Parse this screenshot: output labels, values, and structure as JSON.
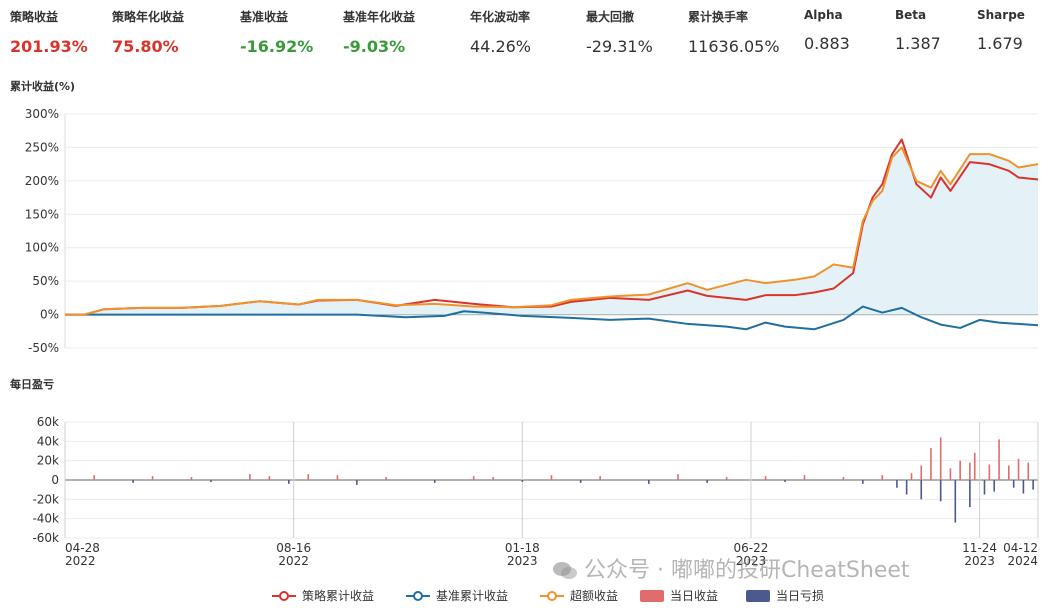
{
  "metrics": [
    {
      "label": "策略收益",
      "value": "201.93%",
      "tone": "red"
    },
    {
      "label": "策略年化收益",
      "value": "75.80%",
      "tone": "red"
    },
    {
      "label": "基准收益",
      "value": "-16.92%",
      "tone": "green"
    },
    {
      "label": "基准年化收益",
      "value": "-9.03%",
      "tone": "green"
    },
    {
      "label": "年化波动率",
      "value": "44.26%",
      "tone": "plain"
    },
    {
      "label": "最大回撤",
      "value": "-29.31%",
      "tone": "plain"
    },
    {
      "label": "累计换手率",
      "value": "11636.05%",
      "tone": "plain"
    },
    {
      "label": "Alpha",
      "value": "0.883",
      "tone": "plain"
    },
    {
      "label": "Beta",
      "value": "1.387",
      "tone": "plain"
    },
    {
      "label": "Sharpe",
      "value": "1.679",
      "tone": "plain"
    }
  ],
  "chart_data": [
    {
      "type": "line",
      "title": "累计收益(%)",
      "ylabel": "",
      "yticks": [
        "300%",
        "250%",
        "200%",
        "150%",
        "100%",
        "50%",
        "0%",
        "-50%"
      ],
      "ylim": [
        -50,
        300
      ],
      "x_range": [
        "2022-04-28",
        "2024-04-12"
      ],
      "series": [
        {
          "name": "策略累计收益",
          "color": "#d9342b",
          "t": [
            0,
            0.02,
            0.04,
            0.08,
            0.12,
            0.16,
            0.2,
            0.24,
            0.26,
            0.3,
            0.34,
            0.38,
            0.42,
            0.46,
            0.5,
            0.52,
            0.56,
            0.6,
            0.64,
            0.66,
            0.7,
            0.72,
            0.75,
            0.77,
            0.79,
            0.81,
            0.82,
            0.83,
            0.84,
            0.85,
            0.86,
            0.875,
            0.89,
            0.9,
            0.91,
            0.93,
            0.95,
            0.97,
            0.98,
            1.0
          ],
          "values": [
            0,
            0,
            8,
            10,
            10,
            13,
            20,
            15,
            21,
            22,
            13,
            22,
            16,
            11,
            12,
            19,
            25,
            22,
            36,
            28,
            22,
            29,
            29,
            33,
            39,
            62,
            135,
            175,
            195,
            240,
            262,
            195,
            175,
            205,
            185,
            228,
            225,
            215,
            205,
            202
          ]
        },
        {
          "name": "基准累计收益",
          "color": "#1f6fa0",
          "t": [
            0,
            0.2,
            0.3,
            0.35,
            0.39,
            0.41,
            0.43,
            0.47,
            0.52,
            0.56,
            0.6,
            0.64,
            0.68,
            0.7,
            0.72,
            0.74,
            0.77,
            0.8,
            0.82,
            0.84,
            0.86,
            0.88,
            0.9,
            0.92,
            0.94,
            0.96,
            0.98,
            1.0
          ],
          "values": [
            0,
            0,
            0,
            -4,
            -2,
            5,
            3,
            -2,
            -5,
            -8,
            -6,
            -14,
            -18,
            -22,
            -12,
            -18,
            -22,
            -8,
            12,
            3,
            10,
            -4,
            -15,
            -20,
            -8,
            -12,
            -14,
            -16
          ]
        },
        {
          "name": "超额收益",
          "color": "#f0922b",
          "fill": "#e4f2f8",
          "t": [
            0,
            0.02,
            0.04,
            0.08,
            0.12,
            0.16,
            0.2,
            0.24,
            0.26,
            0.3,
            0.34,
            0.38,
            0.42,
            0.46,
            0.5,
            0.52,
            0.56,
            0.6,
            0.64,
            0.66,
            0.7,
            0.72,
            0.75,
            0.77,
            0.79,
            0.81,
            0.82,
            0.83,
            0.84,
            0.85,
            0.86,
            0.875,
            0.89,
            0.9,
            0.91,
            0.93,
            0.95,
            0.97,
            0.98,
            1.0
          ],
          "values": [
            0,
            0,
            8,
            10,
            10,
            13,
            20,
            15,
            22,
            22,
            14,
            16,
            12,
            11,
            14,
            22,
            27,
            30,
            47,
            37,
            52,
            47,
            52,
            57,
            75,
            70,
            140,
            170,
            185,
            235,
            250,
            200,
            190,
            215,
            195,
            240,
            240,
            230,
            220,
            225
          ]
        }
      ]
    },
    {
      "type": "bar",
      "title": "每日盈亏",
      "yticks": [
        "60k",
        "40k",
        "20k",
        "0",
        "-20k",
        "-40k",
        "-60k"
      ],
      "ylim": [
        -60000,
        60000
      ],
      "xticks": [
        {
          "t": 0.0,
          "date": "04-28",
          "year": "2022"
        },
        {
          "t": 0.235,
          "date": "08-16",
          "year": "2022"
        },
        {
          "t": 0.47,
          "date": "01-18",
          "year": "2023"
        },
        {
          "t": 0.705,
          "date": "06-22",
          "year": "2023"
        },
        {
          "t": 0.94,
          "date": "11-24",
          "year": "2023"
        },
        {
          "t": 1.0,
          "date": "04-12",
          "year": "2024"
        }
      ],
      "series": [
        {
          "name": "当日收益",
          "color": "#e06c6c",
          "t": [
            0.03,
            0.09,
            0.13,
            0.19,
            0.21,
            0.25,
            0.28,
            0.33,
            0.42,
            0.44,
            0.5,
            0.55,
            0.63,
            0.68,
            0.72,
            0.76,
            0.8,
            0.84,
            0.87,
            0.88,
            0.89,
            0.9,
            0.91,
            0.92,
            0.93,
            0.935,
            0.95,
            0.96,
            0.97,
            0.98,
            0.99
          ],
          "values": [
            5000,
            4000,
            3000,
            6000,
            4000,
            6000,
            5000,
            3000,
            4000,
            3000,
            5000,
            4000,
            6000,
            3000,
            4000,
            5000,
            3000,
            5000,
            7000,
            15000,
            33000,
            44000,
            12000,
            20000,
            18000,
            28000,
            16000,
            42000,
            15000,
            22000,
            18000
          ]
        },
        {
          "name": "当日亏损",
          "color": "#4a5a8f",
          "t": [
            0.07,
            0.15,
            0.23,
            0.3,
            0.38,
            0.47,
            0.53,
            0.6,
            0.66,
            0.74,
            0.82,
            0.855,
            0.865,
            0.88,
            0.9,
            0.915,
            0.93,
            0.945,
            0.955,
            0.975,
            0.985,
            0.995
          ],
          "values": [
            -3000,
            -2000,
            -4000,
            -5000,
            -3000,
            -2000,
            -3000,
            -4000,
            -3000,
            -2000,
            -4000,
            -8000,
            -15000,
            -20000,
            -22000,
            -44000,
            -28000,
            -15000,
            -12000,
            -8000,
            -14000,
            -10000
          ]
        }
      ]
    }
  ],
  "legend": [
    {
      "label": "策略累计收益",
      "color": "#d9342b",
      "kind": "line"
    },
    {
      "label": "基准累计收益",
      "color": "#1f6fa0",
      "kind": "line"
    },
    {
      "label": "超额收益",
      "color": "#f0922b",
      "kind": "line"
    },
    {
      "label": "当日收益",
      "color": "#e06c6c",
      "kind": "rect"
    },
    {
      "label": "当日亏损",
      "color": "#4a5a8f",
      "kind": "rect"
    }
  ],
  "watermark": {
    "text": "公众号 · 嘟嘟的投研CheatSheet",
    "icon": "wechat-icon"
  }
}
